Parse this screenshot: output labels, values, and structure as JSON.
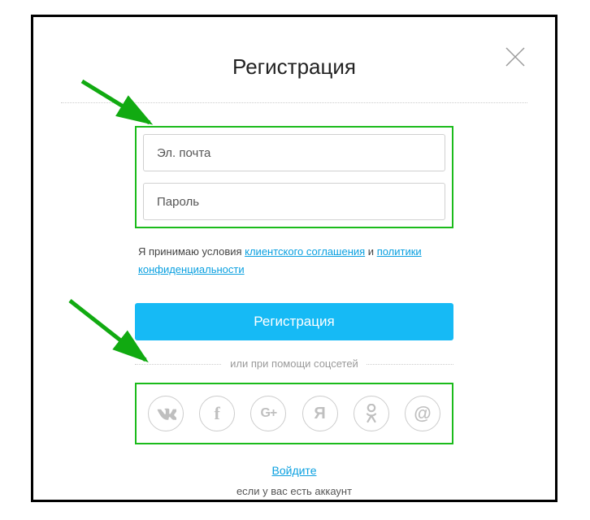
{
  "title": "Регистрация",
  "fields": {
    "email_placeholder": "Эл. почта",
    "password_placeholder": "Пароль"
  },
  "terms": {
    "prefix": "Я принимаю условия ",
    "link1": "клиентского соглашения",
    "mid": " и ",
    "link2": "политики конфиденциальности"
  },
  "register_button": "Регистрация",
  "social_divider": "или при помощи соцсетей",
  "social": {
    "vk": "VK",
    "fb": "f",
    "gplus": "G+",
    "ya": "Я",
    "ok": "OK",
    "mail": "@"
  },
  "login_link": "Войдите",
  "have_account": "если у вас есть аккаунт"
}
